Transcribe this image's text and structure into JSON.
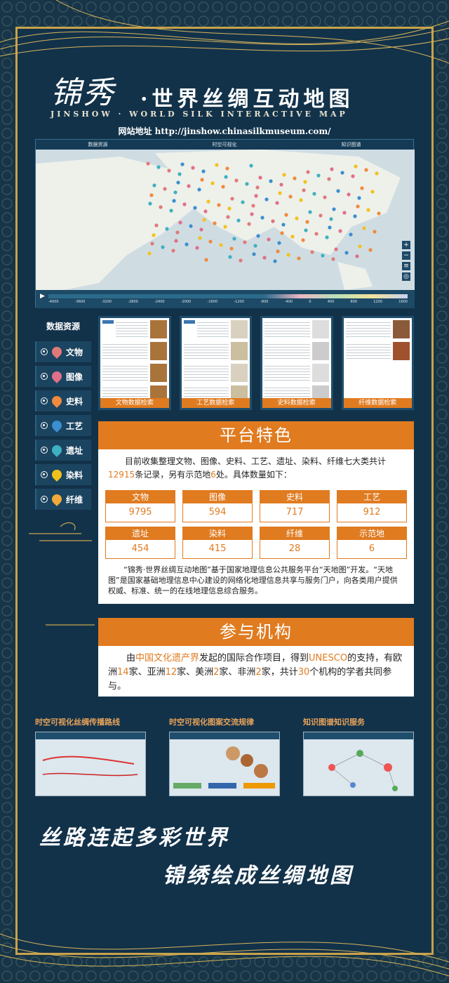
{
  "header": {
    "logo_text": "锦秀",
    "title_cn": "·世界丝绸互动地图",
    "title_en": "JINSHOW · WORLD SILK INTERACTIVE MAP",
    "site_url": "网站地址 http://jinshow.chinasilkmuseum.com/"
  },
  "map": {
    "nav": [
      "数据资源",
      "时空可视化",
      "知识图谱"
    ],
    "timeline_ticks": [
      "-4000",
      "-3600",
      "-3200",
      "-2800",
      "-2400",
      "-2000",
      "-1600",
      "-1200",
      "-800",
      "-400",
      "0",
      "400",
      "800",
      "1200",
      "1600"
    ]
  },
  "sidebar": {
    "title": "数据资源",
    "items": [
      {
        "label": "文物",
        "color": "#e07a7a"
      },
      {
        "label": "图像",
        "color": "#e06f88"
      },
      {
        "label": "史料",
        "color": "#f08a3c"
      },
      {
        "label": "工艺",
        "color": "#3a8fd0"
      },
      {
        "label": "遗址",
        "color": "#3fb0c0"
      },
      {
        "label": "染料",
        "color": "#f2c21c"
      },
      {
        "label": "纤维",
        "color": "#f0a93a"
      }
    ]
  },
  "cards": [
    {
      "caption": "文物数据检索"
    },
    {
      "caption": "工艺数据检索"
    },
    {
      "caption": "史料数据检索"
    },
    {
      "caption": "纤维数据检索"
    }
  ],
  "features": {
    "title": "平台特色",
    "text_a": "目前收集整理文物、图像、史料、工艺、遗址、染料、纤维七大类共计",
    "records": "12915",
    "text_b": "条记录，另有示范地",
    "sites": "6",
    "text_c": "处。具体数量如下：",
    "stats": [
      {
        "k": "文物",
        "v": "9795"
      },
      {
        "k": "图像",
        "v": "594"
      },
      {
        "k": "史料",
        "v": "717"
      },
      {
        "k": "工艺",
        "v": "912"
      },
      {
        "k": "遗址",
        "v": "454"
      },
      {
        "k": "染料",
        "v": "415"
      },
      {
        "k": "纤维",
        "v": "28"
      },
      {
        "k": "示范地",
        "v": "6"
      }
    ],
    "intro": "“锦秀·世界丝绸互动地图”基于国家地理信息公共服务平台“天地图”开发。“天地图”是国家基础地理信息中心建设的网络化地理信息共享与服务门户，向各类用户提供权威、标准、统一的在线地理信息综合服务。"
  },
  "partners": {
    "title": "参与机构",
    "t1": "由",
    "h1": "中国文化遗产界",
    "t2": "发起的国际合作项目，得到",
    "h2": "UNESCO",
    "t3": "的支持，有欧洲",
    "h3": "14",
    "t4": "家、亚洲",
    "h4": "12",
    "t5": "家、美洲",
    "h5": "2",
    "t6": "家、非洲",
    "h6": "2",
    "t7": "家，共计",
    "h7": "30",
    "t8": "个机构的学者共同参与。"
  },
  "showcase": [
    {
      "title": "时空可视化丝绸传播路线"
    },
    {
      "title": "时空可视化图案交流规律"
    },
    {
      "title": "知识图谱知识服务"
    }
  ],
  "slogans": {
    "line1": "丝路连起多彩世界",
    "line2": "锦绣绘成丝绸地图"
  }
}
